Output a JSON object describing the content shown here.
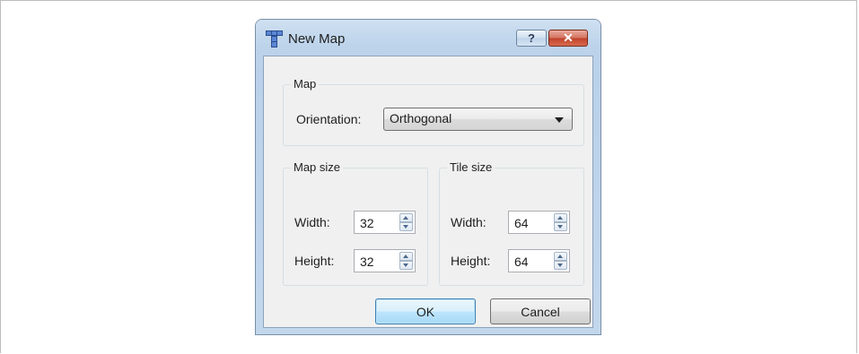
{
  "dialog": {
    "title": "New Map",
    "help_label": "?",
    "close_label": "✕"
  },
  "map_group": {
    "title": "Map",
    "orientation_label": "Orientation:",
    "orientation_value": "Orthogonal"
  },
  "map_size": {
    "title": "Map size",
    "width_label": "Width:",
    "width_value": "32",
    "height_label": "Height:",
    "height_value": "32"
  },
  "tile_size": {
    "title": "Tile size",
    "width_label": "Width:",
    "width_value": "64",
    "height_label": "Height:",
    "height_value": "64"
  },
  "buttons": {
    "ok_label": "OK",
    "cancel_label": "Cancel"
  },
  "colors": {
    "title_bar": "#bcd3ea",
    "client_bg": "#f0f0f0",
    "close_button": "#c1412a",
    "ok_button_border": "#3c7fb1"
  },
  "icons": [
    "tiled-app-icon",
    "help-icon",
    "close-icon",
    "dropdown-arrow-icon",
    "spin-up-icon",
    "spin-down-icon"
  ]
}
